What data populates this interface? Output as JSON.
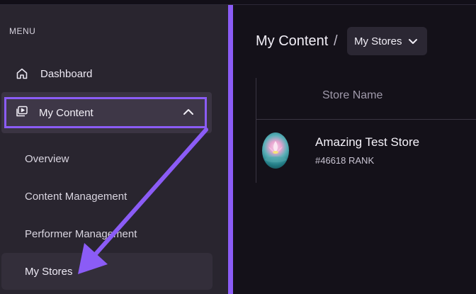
{
  "sidebar": {
    "menu_label": "MENU",
    "dashboard_label": "Dashboard",
    "my_content_label": "My Content",
    "sub_items": [
      "Overview",
      "Content Management",
      "Performer Management",
      "My Stores"
    ]
  },
  "main": {
    "breadcrumb_title": "My Content",
    "breadcrumb_separator": "/",
    "store_select_value": "My Stores",
    "table": {
      "column_header": "Store Name",
      "rows": [
        {
          "name": "Amazing Test Store",
          "rank": "#46618 RANK"
        }
      ]
    }
  },
  "colors": {
    "accent": "#8b5cf6",
    "sidebar_bg": "#29252f",
    "main_bg": "#141119"
  },
  "icons": [
    "home-icon",
    "video-icon",
    "chevron-up-icon",
    "chevron-down-icon"
  ]
}
